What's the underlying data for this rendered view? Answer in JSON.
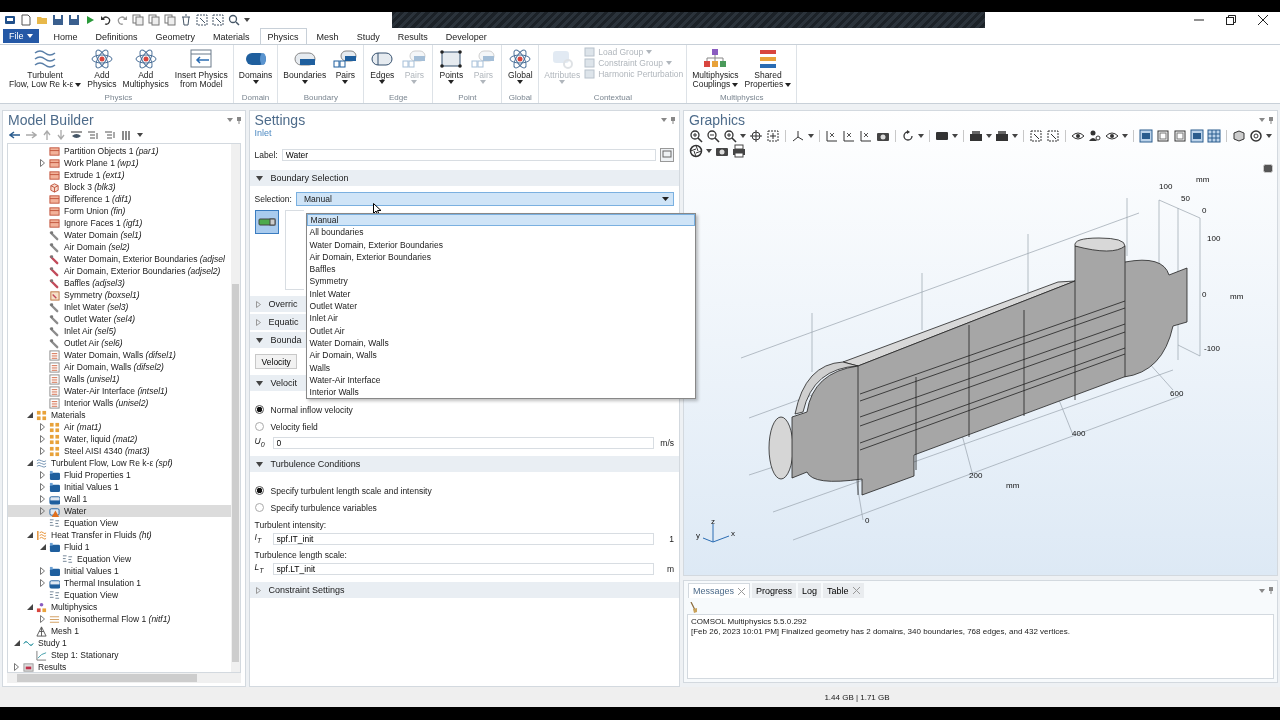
{
  "menu": {
    "file_label": "File",
    "tabs": [
      {
        "label": "Home",
        "selected": false
      },
      {
        "label": "Definitions",
        "selected": false
      },
      {
        "label": "Geometry",
        "selected": false
      },
      {
        "label": "Materials",
        "selected": false
      },
      {
        "label": "Physics",
        "selected": true
      },
      {
        "label": "Mesh",
        "selected": false
      },
      {
        "label": "Study",
        "selected": false
      },
      {
        "label": "Results",
        "selected": false
      },
      {
        "label": "Developer",
        "selected": false
      }
    ]
  },
  "ribbon": [
    {
      "title": "Physics",
      "items": [
        {
          "kind": "large",
          "lines": [
            "Turbulent",
            "Flow, Low Re k-ε"
          ],
          "dropdown": true,
          "disabled": false
        },
        {
          "kind": "large",
          "lines": [
            "Add",
            "Physics"
          ],
          "dropdown": false,
          "disabled": false
        },
        {
          "kind": "large",
          "lines": [
            "Add",
            "Multiphysics"
          ],
          "dropdown": false,
          "disabled": false
        },
        {
          "kind": "large",
          "lines": [
            "Insert Physics",
            "from Model"
          ],
          "dropdown": false,
          "disabled": false
        }
      ]
    },
    {
      "title": "Domain",
      "items": [
        {
          "kind": "large",
          "lines": [
            "Domains"
          ],
          "dropdown": true,
          "disabled": false
        }
      ]
    },
    {
      "title": "Boundary",
      "items": [
        {
          "kind": "large",
          "lines": [
            "Boundaries"
          ],
          "dropdown": true,
          "disabled": false
        },
        {
          "kind": "large",
          "lines": [
            "Pairs"
          ],
          "dropdown": true,
          "disabled": false
        }
      ]
    },
    {
      "title": "Edge",
      "items": [
        {
          "kind": "large",
          "lines": [
            "Edges"
          ],
          "dropdown": true,
          "disabled": false
        },
        {
          "kind": "large",
          "lines": [
            "Pairs"
          ],
          "dropdown": true,
          "disabled": true
        }
      ]
    },
    {
      "title": "Point",
      "items": [
        {
          "kind": "large",
          "lines": [
            "Points"
          ],
          "dropdown": true,
          "disabled": false
        },
        {
          "kind": "large",
          "lines": [
            "Pairs"
          ],
          "dropdown": true,
          "disabled": true
        }
      ]
    },
    {
      "title": "Global",
      "items": [
        {
          "kind": "large",
          "lines": [
            "Global"
          ],
          "dropdown": true,
          "disabled": false
        }
      ]
    },
    {
      "title": "Contextual",
      "items": [
        {
          "kind": "large",
          "lines": [
            "Attributes"
          ],
          "dropdown": true,
          "disabled": true
        },
        {
          "kind": "small",
          "lines": [
            "Load Group"
          ],
          "dropdown": true,
          "disabled": true
        },
        {
          "kind": "small",
          "lines": [
            "Constraint Group"
          ],
          "dropdown": true,
          "disabled": true
        },
        {
          "kind": "small",
          "lines": [
            "Harmonic Perturbation"
          ],
          "dropdown": false,
          "disabled": true
        }
      ]
    },
    {
      "title": "Multiphysics",
      "items": [
        {
          "kind": "large",
          "lines": [
            "Multiphysics",
            "Couplings"
          ],
          "dropdown": true,
          "disabled": false
        },
        {
          "kind": "large",
          "lines": [
            "Shared",
            "Properties"
          ],
          "dropdown": true,
          "disabled": false
        }
      ]
    }
  ],
  "model_builder": {
    "title": "Model Builder",
    "tree": [
      {
        "children": [
          {
            "children": [
              {
                "label": "Partition Objects 1 *(par1)*",
                "kind": "geometry",
                "selected": false
              },
              {
                "label": "Work Plane 1 *(wp1)*",
                "kind": "geometry",
                "expanded": false,
                "selected": false
              },
              {
                "label": "Extrude 1 *(ext1)*",
                "kind": "geometry",
                "selected": false
              },
              {
                "label": "Block 3 *(blk3)*",
                "kind": "block",
                "selected": false
              },
              {
                "label": "Difference 1 *(dif1)*",
                "kind": "geometry",
                "selected": false
              },
              {
                "label": "Form Union *(fin)*",
                "kind": "geometry",
                "selected": false
              },
              {
                "label": "Ignore Faces 1 *(igf1)*",
                "kind": "geometry",
                "selected": false
              },
              {
                "label": "Water Domain *(sel1)*",
                "kind": "selection",
                "selected": false
              },
              {
                "label": "Air Domain *(sel2)*",
                "kind": "selection",
                "selected": false
              },
              {
                "label": "Water Domain, Exterior Boundaries *(adjsel*",
                "kind": "selection-adjacent",
                "selected": false
              },
              {
                "label": "Air Domain, Exterior Boundaries *(adjsel2)*",
                "kind": "selection-adjacent",
                "selected": false
              },
              {
                "label": "Baffles *(adjsel3)*",
                "kind": "selection-adjacent",
                "selected": false
              },
              {
                "label": "Symmetry *(boxsel1)*",
                "kind": "selection-box",
                "selected": false
              },
              {
                "label": "Inlet Water *(sel3)*",
                "kind": "selection",
                "selected": false
              },
              {
                "label": "Outlet Water *(sel4)*",
                "kind": "selection",
                "selected": false
              },
              {
                "label": "Inlet Air *(sel5)*",
                "kind": "selection",
                "selected": false
              },
              {
                "label": "Outlet Air *(sel6)*",
                "kind": "selection",
                "selected": false
              },
              {
                "label": "Water Domain, Walls *(difsel1)*",
                "kind": "selection-list",
                "selected": false
              },
              {
                "label": "Air Domain, Walls *(difsel2)*",
                "kind": "selection-list",
                "selected": false
              },
              {
                "label": "Walls *(unisel1)*",
                "kind": "selection-list",
                "selected": false
              },
              {
                "label": "Water-Air Interface *(intsel1)*",
                "kind": "selection-list",
                "selected": false
              },
              {
                "label": "Interior Walls *(unisel2)*",
                "kind": "selection-list",
                "selected": false
              }
            ]
          },
          {
            "label": "Materials",
            "kind": "material",
            "expanded": true,
            "selected": false,
            "children": [
              {
                "label": "Air *(mat1)*",
                "kind": "material",
                "expanded": false,
                "selected": false
              },
              {
                "label": "Water, liquid *(mat2)*",
                "kind": "material",
                "expanded": false,
                "selected": false
              },
              {
                "label": "Steel AISI 4340 *(mat3)*",
                "kind": "material",
                "expanded": false,
                "selected": false
              }
            ]
          },
          {
            "label": "Turbulent Flow, Low Re k-ε *(spf)*",
            "kind": "flow",
            "expanded": true,
            "selected": false,
            "children": [
              {
                "label": "Fluid Properties 1",
                "kind": "domain",
                "expanded": false,
                "selected": false
              },
              {
                "label": "Initial Values 1",
                "kind": "domain",
                "expanded": false,
                "selected": false
              },
              {
                "label": "Wall 1",
                "kind": "boundary",
                "expanded": false,
                "selected": false
              },
              {
                "label": "Water",
                "kind": "boundary-warning",
                "expanded": false,
                "selected": true
              },
              {
                "label": "Equation View",
                "kind": "equation",
                "selected": false
              }
            ]
          },
          {
            "label": "Heat Transfer in Fluids *(ht)*",
            "kind": "heat",
            "expanded": true,
            "selected": false,
            "children": [
              {
                "label": "Fluid 1",
                "kind": "domain",
                "expanded": true,
                "selected": false,
                "children": [
                  {
                    "label": "Equation View",
                    "kind": "equation",
                    "selected": false
                  }
                ]
              },
              {
                "label": "Initial Values 1",
                "kind": "domain",
                "expanded": false,
                "selected": false
              },
              {
                "label": "Thermal Insulation 1",
                "kind": "boundary",
                "expanded": false,
                "selected": false
              },
              {
                "label": "Equation View",
                "kind": "equation",
                "selected": false
              }
            ]
          },
          {
            "label": "Multiphysics",
            "kind": "multiphysics",
            "expanded": true,
            "selected": false,
            "children": [
              {
                "label": "Nonisothermal Flow 1 *(nitf1)*",
                "kind": "coupling",
                "expanded": false,
                "selected": false
              }
            ]
          },
          {
            "label": "Mesh 1",
            "kind": "mesh",
            "selected": false
          }
        ]
      },
      {
        "label": "Study 1",
        "kind": "study",
        "expanded": true,
        "selected": false,
        "children": [
          {
            "label": "Step 1: Stationary",
            "kind": "step",
            "selected": false
          }
        ]
      },
      {
        "label": "Results",
        "kind": "results",
        "expanded": false,
        "selected": false
      }
    ]
  },
  "settings": {
    "title": "Settings",
    "subtitle": "Inlet",
    "label_caption": "Label:",
    "label_value": "Water",
    "sections": [
      {
        "title": "Boundary Selection",
        "expanded": true,
        "kind": "selection",
        "caption": "Selection:",
        "value": "Manual"
      },
      {
        "title": "Overric",
        "expanded": false
      },
      {
        "title": "Equatic",
        "expanded": false
      },
      {
        "title": "Bounda",
        "expanded": true,
        "kind": "button",
        "button": "Velocity"
      },
      {
        "title": "Velocit",
        "expanded": true,
        "kind": "radios",
        "radios": [
          {
            "label": "Normal inflow velocity",
            "selected": true
          },
          {
            "label": "Velocity field",
            "selected": false
          }
        ],
        "fields": [
          {
            "symbol": "U$_{0}$",
            "value": "0",
            "unit": "m/s"
          }
        ]
      },
      {
        "title": "Turbulence Conditions",
        "expanded": true,
        "kind": "radios",
        "radios": [
          {
            "label": "Specify turbulent length scale and intensity",
            "selected": true
          },
          {
            "label": "Specify turbulence variables",
            "selected": false
          }
        ],
        "fields": [
          {
            "caption": "Turbulent intensity:",
            "symbol": "I$_{T}$",
            "value": "spf.IT_init",
            "unit": "1"
          },
          {
            "caption": "Turbulence length scale:",
            "symbol": "L$_{T}$",
            "value": "spf.LT_init",
            "unit": "m"
          }
        ]
      },
      {
        "title": "Constraint Settings",
        "expanded": false
      }
    ],
    "dropdown": {
      "options": [
        {
          "label": "Manual",
          "selected": true
        },
        {
          "label": "All boundaries",
          "selected": false
        },
        {
          "label": "Water Domain, Exterior Boundaries",
          "selected": false
        },
        {
          "label": "Air Domain, Exterior Boundaries",
          "selected": false
        },
        {
          "label": "Baffles",
          "selected": false
        },
        {
          "label": "Symmetry",
          "selected": false
        },
        {
          "label": "Inlet Water",
          "selected": false
        },
        {
          "label": "Outlet Water",
          "selected": false
        },
        {
          "label": "Inlet Air",
          "selected": false
        },
        {
          "label": "Outlet Air",
          "selected": false
        },
        {
          "label": "Water Domain, Walls",
          "selected": false
        },
        {
          "label": "Air Domain, Walls",
          "selected": false
        },
        {
          "label": "Walls",
          "selected": false
        },
        {
          "label": "Water-Air Interface",
          "selected": false
        },
        {
          "label": "Interior Walls",
          "selected": false
        }
      ]
    }
  },
  "graphics": {
    "title": "Graphics",
    "axis_labels": [
      "mm",
      "100",
      "50",
      "0",
      "100",
      "0",
      "mm",
      "-100",
      "600",
      "400",
      "200",
      "mm",
      "0"
    ],
    "triad": [
      "z",
      "y",
      "x"
    ]
  },
  "messages": {
    "tabs": [
      {
        "label": "Messages",
        "selected": true,
        "closable": true
      },
      {
        "label": "Progress",
        "selected": false,
        "closable": false
      },
      {
        "label": "Log",
        "selected": false,
        "closable": false
      },
      {
        "label": "Table",
        "selected": false,
        "closable": true
      }
    ],
    "lines": [
      "COMSOL Multiphysics 5.5.0.292",
      "[Feb 26, 2023 10:01 PM] Finalized geometry has 2 domains, 340 boundaries, 768 edges, and 432 vertices."
    ]
  },
  "status_bar": {
    "memory": "1.44 GB | 1.71 GB"
  }
}
